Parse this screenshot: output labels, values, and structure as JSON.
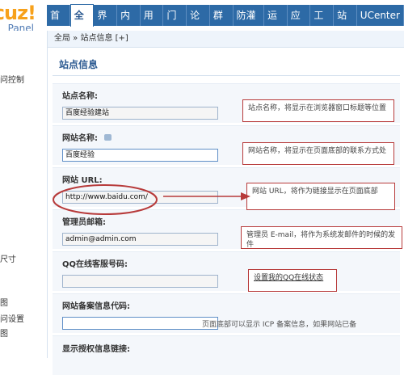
{
  "logo": {
    "mark": "cuz!",
    "sub": "Panel"
  },
  "nav": {
    "items": [
      "首页",
      "全局",
      "界面",
      "内容",
      "用户",
      "门户",
      "论坛",
      "群组",
      "防灌水",
      "运营",
      "应用",
      "工具",
      "站长",
      "UCenter"
    ]
  },
  "sidebar": {
    "items": [
      "问控制",
      "尺寸",
      "图",
      "问设置",
      "图"
    ]
  },
  "breadcrumb": {
    "text": "全局 » 站点信息 [+]"
  },
  "section": {
    "title": "站点信息"
  },
  "fields": {
    "site_name": {
      "label": "站点名称:",
      "value": "百度经验建站"
    },
    "network_name": {
      "label": "网站名称:",
      "value": "百度经验"
    },
    "site_url": {
      "label": "网站 URL:",
      "value": "http://www.baidu.com/"
    },
    "admin_email": {
      "label": "管理员邮箱:",
      "value": "admin@admin.com"
    },
    "qq_service": {
      "label": "QQ在线客服号码:",
      "value": ""
    },
    "icp": {
      "label": "网站备案信息代码:",
      "value": ""
    },
    "license": {
      "label": "显示授权信息链接:"
    }
  },
  "notes": {
    "site_name": "站点名称，将显示在浏览器窗口标题等位置",
    "network_name": "网站名称，将显示在页面底部的联系方式处",
    "site_url": "网站 URL，将作为链接显示在页面底部",
    "admin_email": "管理员 E-mail，将作为系统发邮件的时候的发件",
    "qq_link": "设置我的QQ在线状态",
    "icp_hint": "页面底部可以显示 ICP 备案信息，如果网站已备"
  },
  "colors": {
    "nav": "#2d6aa6",
    "annotation": "#b73a3a",
    "logo": "#f7a11b"
  }
}
